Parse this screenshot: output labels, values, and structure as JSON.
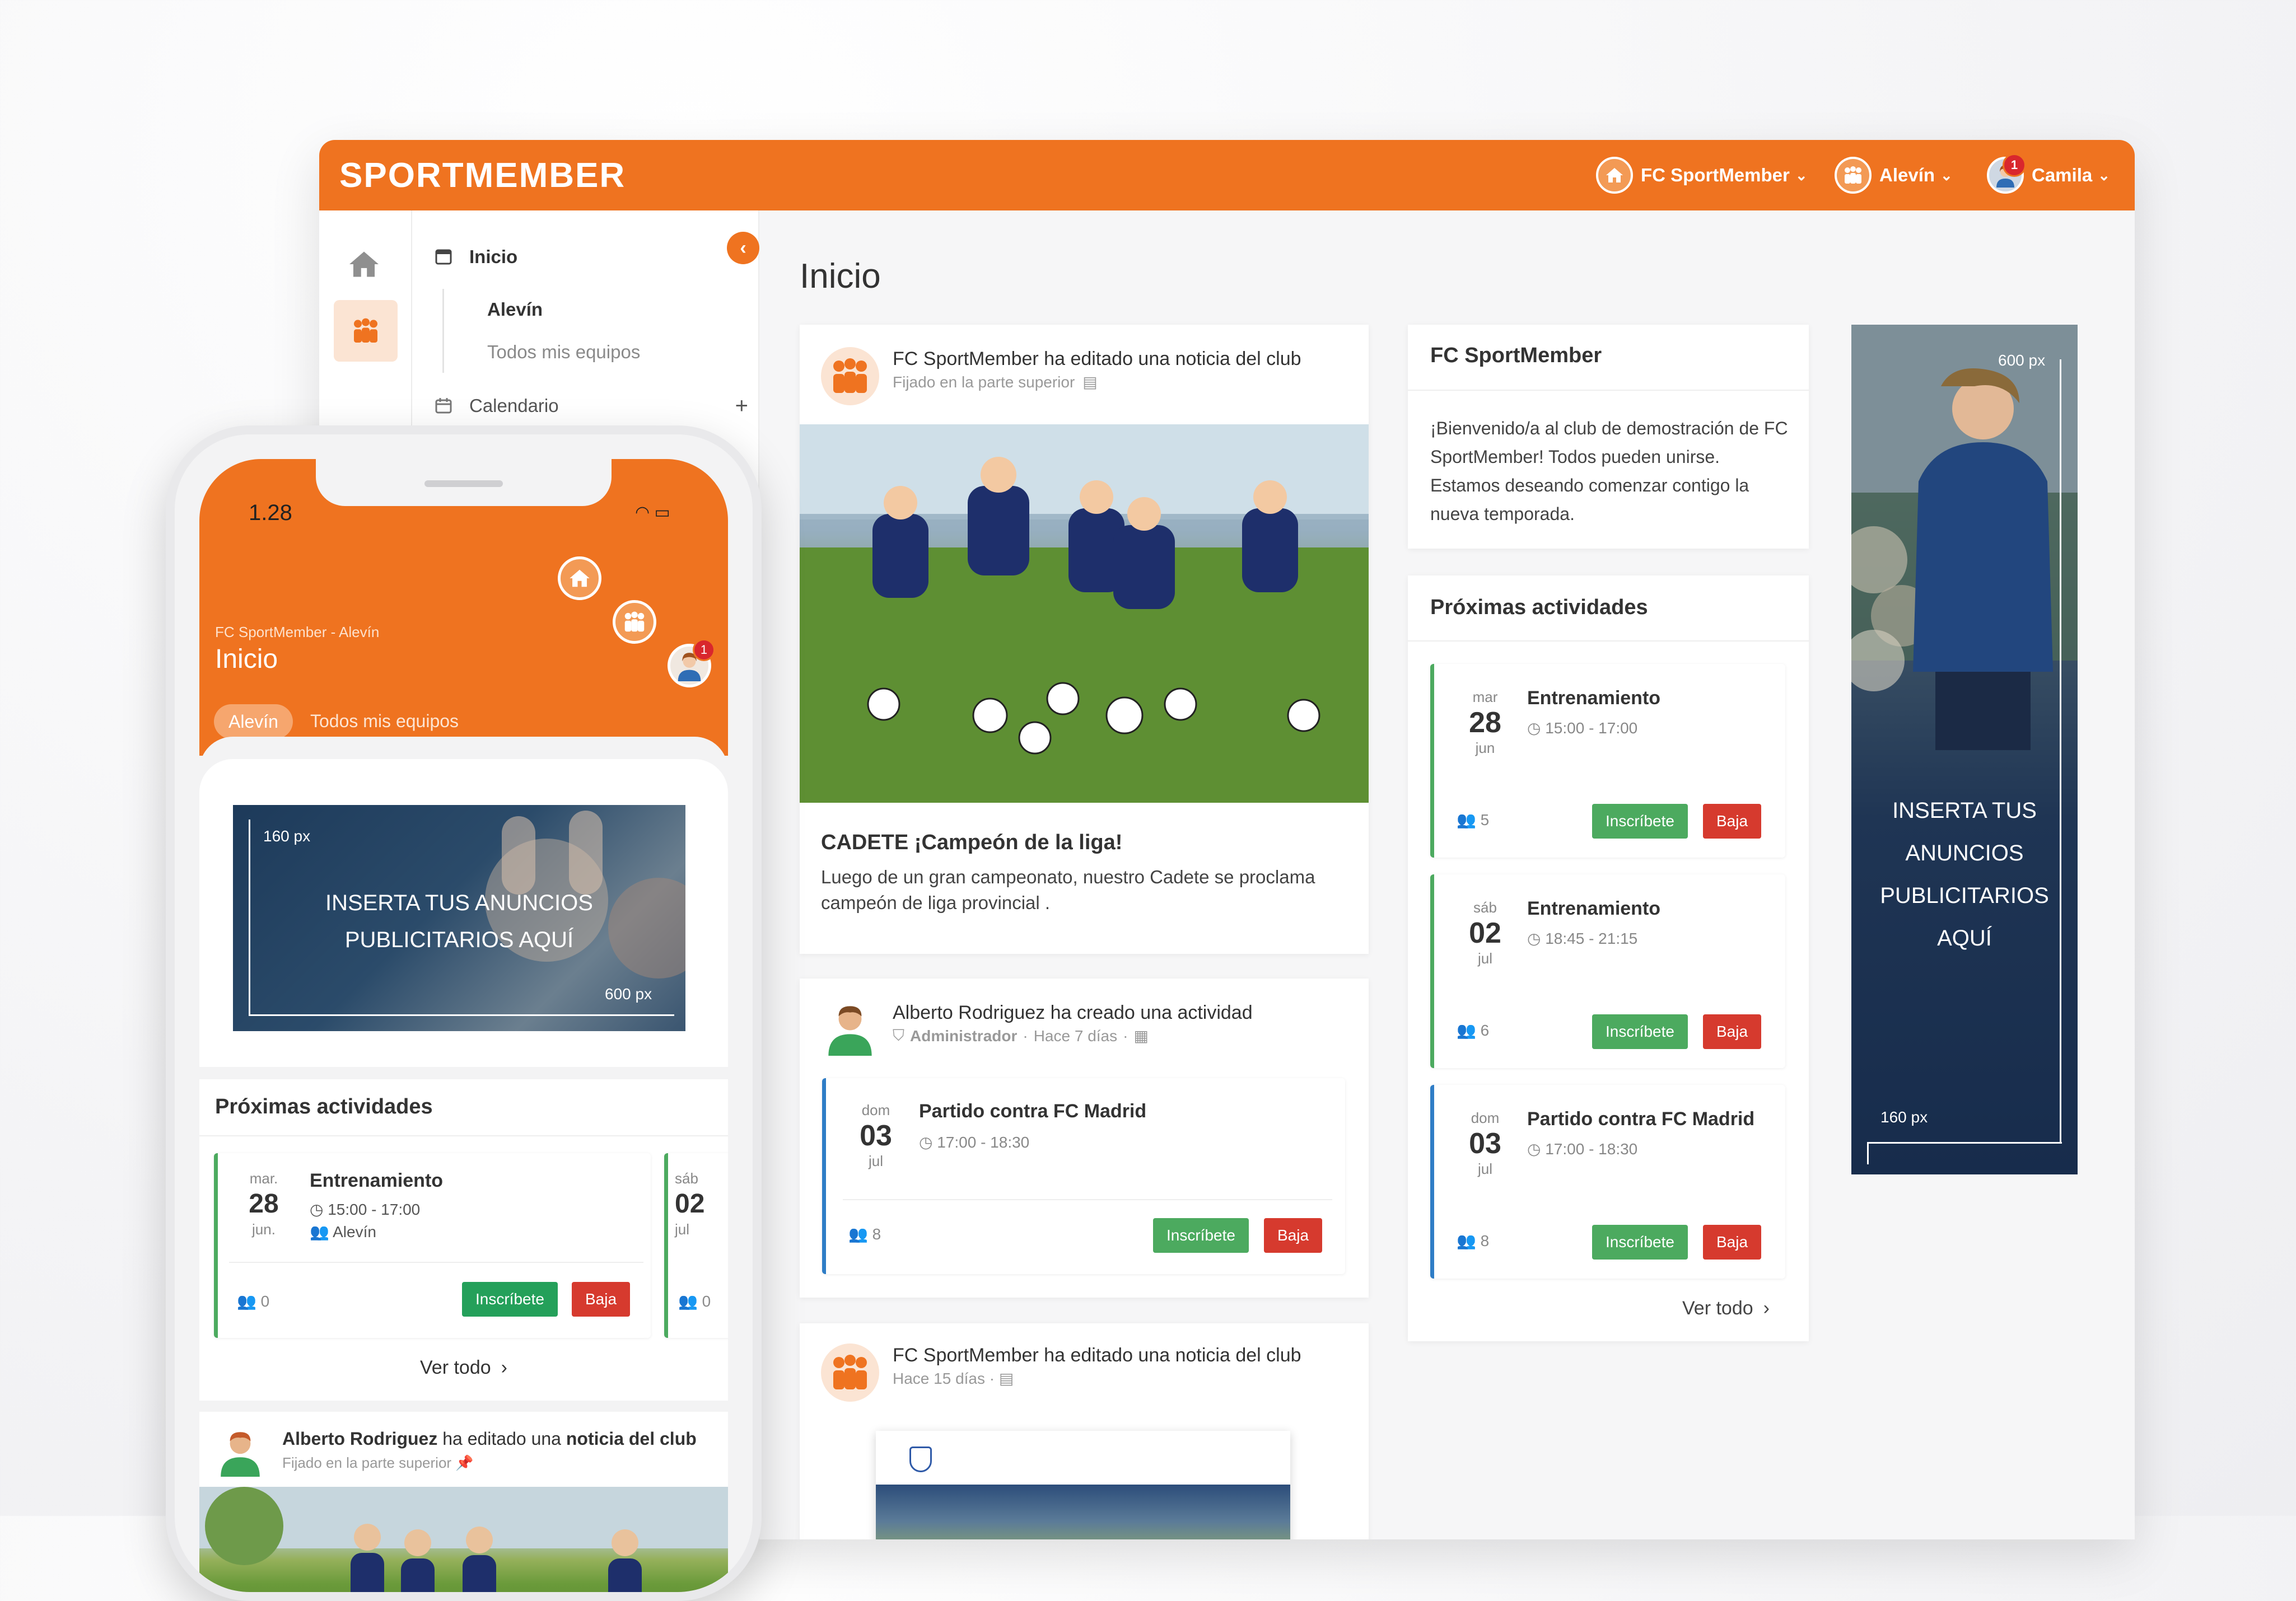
{
  "brand": {
    "logo": "SPORTMEMBER",
    "accent": "#ef7320"
  },
  "topbar": {
    "club": "FC SportMember",
    "team": "Alevín",
    "user": "Camila",
    "notifications": "1"
  },
  "sidebar": {
    "items": [
      {
        "label": "Inicio",
        "icon": "calendar-page-icon",
        "action": "–"
      },
      {
        "label": "Calendario",
        "icon": "calendar-icon",
        "action": "+"
      }
    ],
    "subitems": [
      "Alevín",
      "Todos mis equipos"
    ]
  },
  "main": {
    "title": "Inicio",
    "post1": {
      "header": "FC SportMember ha editado una noticia del club",
      "meta": "Fijado en la parte superior",
      "title": "CADETE ¡Campeón de la liga!",
      "body": "Luego de un gran campeonato, nuestro Cadete se proclama campeón de liga provincial ."
    },
    "post2": {
      "header": "Alberto Rodriguez ha creado una actividad",
      "meta_role": "Administrador",
      "meta_time": "Hace 7 días",
      "activity": {
        "dow": "dom",
        "day": "03",
        "month": "jul",
        "title": "Partido contra FC Madrid",
        "time": "17:00 - 18:30",
        "count": "8"
      }
    },
    "post3": {
      "header": "FC SportMember ha editado una noticia del club",
      "meta": "Hace 15 días"
    },
    "buttons": {
      "join": "Inscríbete",
      "leave": "Baja"
    }
  },
  "club_card": {
    "title": "FC SportMember",
    "text": "¡Bienvenido/a al club de demostración de FC SportMember! Todos pueden unirse. Estamos deseando comenzar contigo la nueva temporada."
  },
  "upcoming": {
    "title": "Próximas actividades",
    "items": [
      {
        "dow": "mar",
        "day": "28",
        "month": "jun",
        "title": "Entrenamiento",
        "time": "15:00 - 17:00",
        "count": "5"
      },
      {
        "dow": "sáb",
        "day": "02",
        "month": "jul",
        "title": "Entrenamiento",
        "time": "18:45 - 21:15",
        "count": "6"
      },
      {
        "dow": "dom",
        "day": "03",
        "month": "jul",
        "title": "Partido contra FC Madrid",
        "time": "17:00 - 18:30",
        "count": "8"
      }
    ],
    "see_all": "Ver todo"
  },
  "ad_vertical": {
    "text_lines": [
      "INSERTA TUS",
      "ANUNCIOS",
      "PUBLICITARIOS",
      "AQUÍ"
    ],
    "width_label": "600 px",
    "height_label": "160 px"
  },
  "phone": {
    "time": "1.28",
    "subtitle": "FC SportMember - Alevín",
    "title": "Inicio",
    "chips": [
      "Alevín",
      "Todos mis equipos"
    ],
    "notifications": "1",
    "ad": {
      "lines": [
        "INSERTA TUS ANUNCIOS",
        "PUBLICITARIOS AQUÍ"
      ],
      "height_label": "160 px",
      "width_label": "600 px"
    },
    "upcoming_title": "Próximas actividades",
    "activity": {
      "dow": "mar.",
      "day": "28",
      "month": "jun.",
      "title": "Entrenamiento",
      "time": "15:00 - 17:00",
      "team": "Alevín",
      "count": "0"
    },
    "activity2": {
      "dow": "sáb",
      "day": "02",
      "month": "jul",
      "count": "0"
    },
    "see_all": "Ver todo",
    "post": {
      "author": "Alberto Rodriguez",
      "verb": "ha editado una",
      "object": "noticia del club",
      "meta": "Fijado en la parte superior"
    }
  }
}
